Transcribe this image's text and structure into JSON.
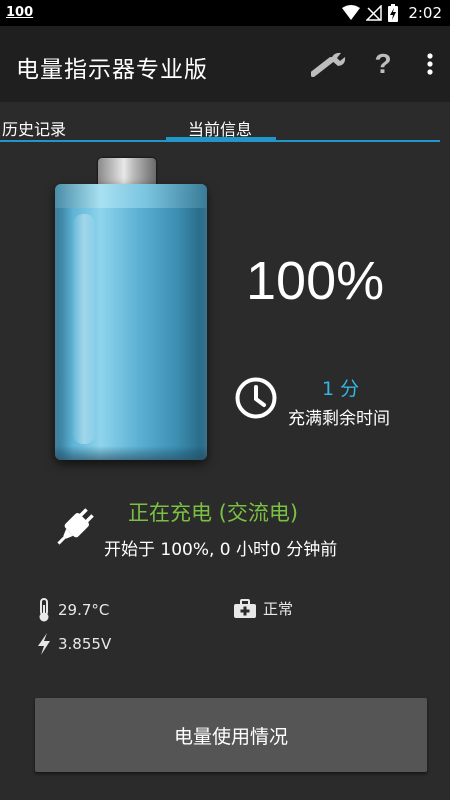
{
  "status_bar": {
    "left_badge": "100",
    "time": "2:02"
  },
  "app_bar": {
    "title": "电量指示器专业版",
    "actions": [
      {
        "icon": "wrench-icon"
      },
      {
        "icon": "help-icon",
        "label": "?"
      },
      {
        "icon": "overflow-menu-icon"
      }
    ]
  },
  "tabs": [
    {
      "label": "历史记录",
      "active": false
    },
    {
      "label": "当前信息",
      "active": true
    }
  ],
  "battery": {
    "level_fraction": 1.0,
    "color": "#5cb1d3",
    "percent_text": "100%"
  },
  "time_remaining": {
    "value": "1 分",
    "label": "充满剩余时间",
    "value_color": "#33b5e5"
  },
  "charging": {
    "status": "正在充电 (交流电)",
    "status_color": "#7ac142",
    "detail": "开始于 100%, 0 小时0 分钟前"
  },
  "stats": {
    "temperature": "29.7°C",
    "voltage": "3.855V",
    "health": "正常"
  },
  "usage_button": {
    "label": "电量使用情况"
  }
}
